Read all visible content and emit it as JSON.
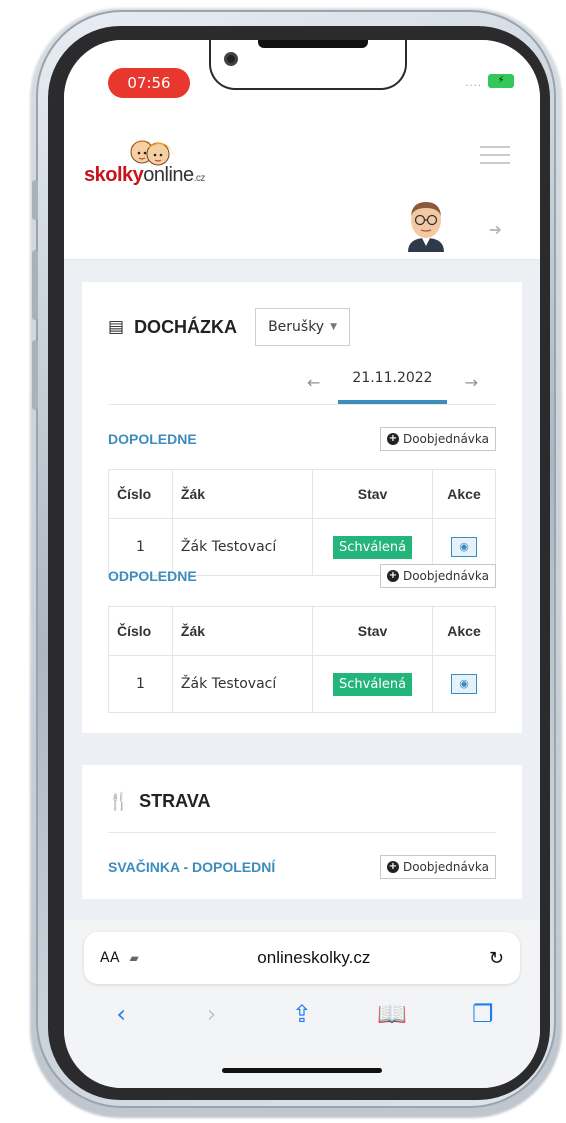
{
  "status_bar": {
    "time": "07:56",
    "signal": "....",
    "battery": "⚡"
  },
  "header": {
    "logo": {
      "skolky": "skolky",
      "online": "online",
      "cz": ".cz"
    },
    "menu_icon": "hamburger-icon",
    "logout_icon": "sign-out-icon"
  },
  "attendance": {
    "title": "DOCHÁZKA",
    "class_select": "Berušky",
    "date": "21.11.2022",
    "sections": [
      {
        "title": "DOPOLEDNE",
        "order_button": "Doobjednávka",
        "columns": [
          "Číslo",
          "Žák",
          "Stav",
          "Akce"
        ],
        "rows": [
          {
            "number": "1",
            "student": "Žák Testovací",
            "status": "Schválená"
          }
        ]
      },
      {
        "title": "ODPOLEDNE",
        "order_button": "Doobjednávka",
        "columns": [
          "Číslo",
          "Žák",
          "Stav",
          "Akce"
        ],
        "rows": [
          {
            "number": "1",
            "student": "Žák Testovací",
            "status": "Schválená"
          }
        ]
      }
    ]
  },
  "meals": {
    "title": "STRAVA",
    "sections": [
      {
        "title": "SVAČINKA - DOPOLEDNÍ",
        "order_button": "Doobjednávka"
      }
    ]
  },
  "safari": {
    "text_size": "AA",
    "url": "onlineskolky.cz",
    "toolbar": [
      "back-icon",
      "forward-icon",
      "share-icon",
      "bookmarks-icon",
      "tabs-icon"
    ]
  },
  "colors": {
    "accent": "#3c8dbc",
    "status_approved": "#24b57b",
    "brand_red": "#c8141e",
    "time_pill": "#e8382e"
  }
}
